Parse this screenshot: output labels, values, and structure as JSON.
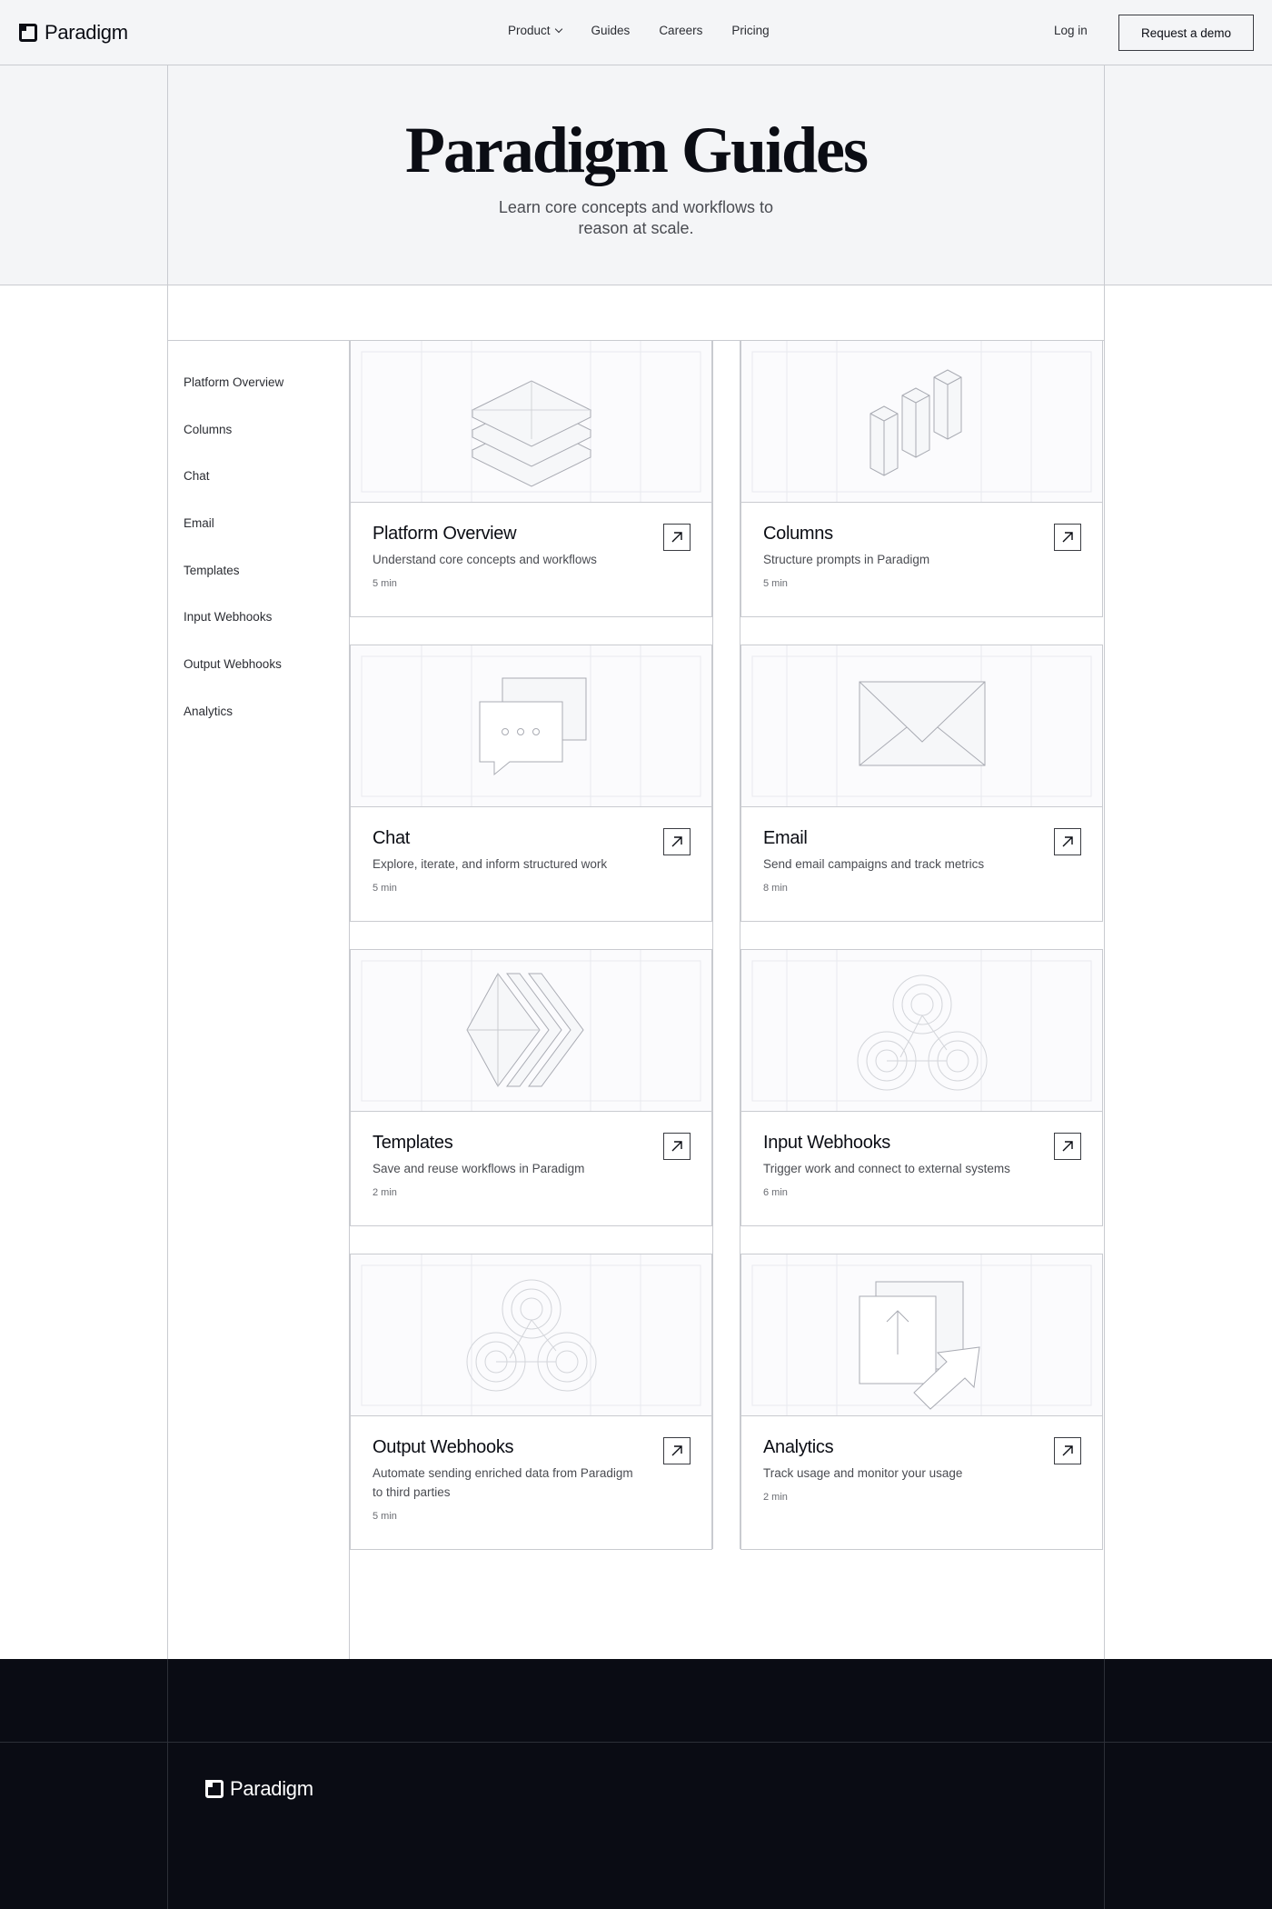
{
  "header": {
    "brand": "Paradigm",
    "nav": [
      "Product",
      "Guides",
      "Careers",
      "Pricing"
    ],
    "login": "Log in",
    "demo": "Request a demo"
  },
  "hero": {
    "title": "Paradigm Guides",
    "subtitle": "Learn core concepts and workflows to reason at scale."
  },
  "sidebar": {
    "items": [
      "Platform Overview",
      "Columns",
      "Chat",
      "Email",
      "Templates",
      "Input Webhooks",
      "Output Webhooks",
      "Analytics"
    ]
  },
  "cards": [
    {
      "title": "Platform Overview",
      "desc": "Understand core concepts and workflows",
      "time": "5 min",
      "icon": "layers-icon"
    },
    {
      "title": "Columns",
      "desc": "Structure prompts in Paradigm",
      "time": "5 min",
      "icon": "columns-icon"
    },
    {
      "title": "Chat",
      "desc": "Explore, iterate, and inform structured work",
      "time": "5 min",
      "icon": "chat-icon"
    },
    {
      "title": "Email",
      "desc": "Send email campaigns and track metrics",
      "time": "8 min",
      "icon": "envelope-icon"
    },
    {
      "title": "Templates",
      "desc": "Save and reuse workflows in Paradigm",
      "time": "2 min",
      "icon": "stacked-diamonds-icon"
    },
    {
      "title": "Input Webhooks",
      "desc": "Trigger work and connect to external systems",
      "time": "6 min",
      "icon": "webhook-icon"
    },
    {
      "title": "Output Webhooks",
      "desc": "Automate sending enriched data from Paradigm to third parties",
      "time": "5 min",
      "icon": "webhook-icon"
    },
    {
      "title": "Analytics",
      "desc": "Track usage and monitor your usage",
      "time": "2 min",
      "icon": "upload-arrow-icon"
    }
  ],
  "footer": {
    "brand": "Paradigm"
  }
}
